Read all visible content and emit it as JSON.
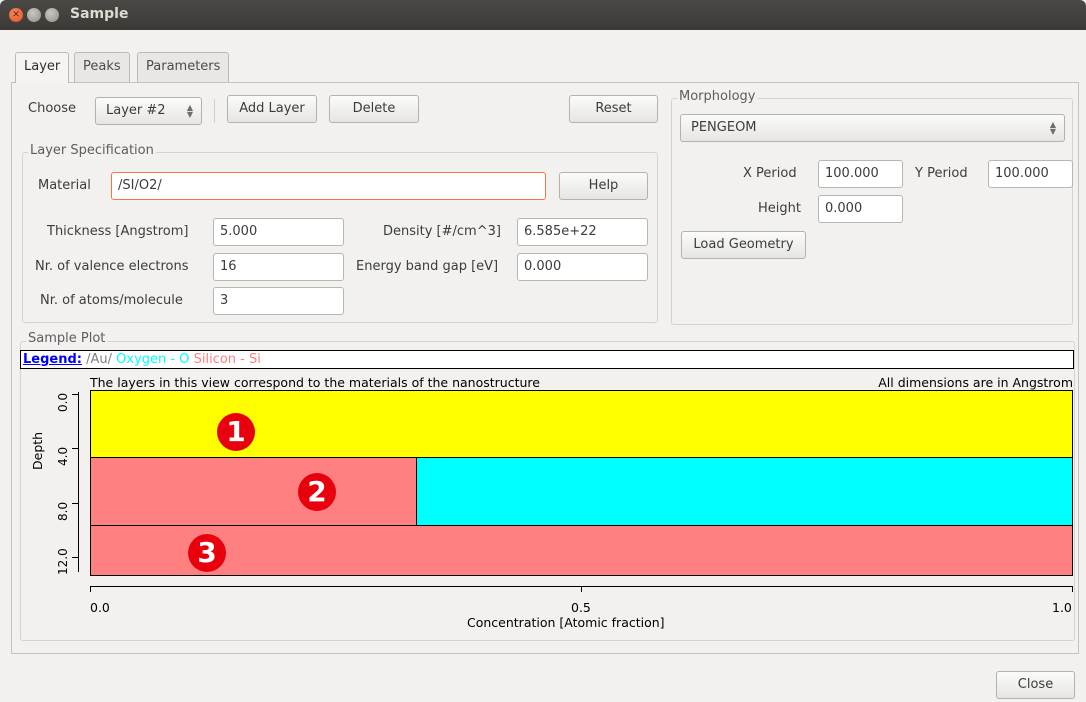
{
  "window": {
    "title": "Sample"
  },
  "tabs": [
    {
      "label": "Layer",
      "active": true
    },
    {
      "label": "Peaks",
      "active": false
    },
    {
      "label": "Parameters",
      "active": false
    }
  ],
  "toolbar": {
    "choose_label": "Choose",
    "layer_select": "Layer #2",
    "add_layer": "Add Layer",
    "delete": "Delete",
    "reset": "Reset"
  },
  "layer_spec": {
    "title": "Layer Specification",
    "material_label": "Material",
    "material_value": "/SI/O2/",
    "help": "Help",
    "thickness_label": "Thickness [Angstrom]",
    "thickness_value": "5.000",
    "density_label": "Density [#/cm^3]",
    "density_value": "6.585e+22",
    "valence_label": "Nr. of valence electrons",
    "valence_value": "16",
    "bandgap_label": "Energy band gap [eV]",
    "bandgap_value": "0.000",
    "atoms_label": "Nr. of atoms/molecule",
    "atoms_value": "3"
  },
  "morphology": {
    "title": "Morphology",
    "select": "PENGEOM",
    "xperiod_label": "X Period",
    "xperiod_value": "100.000",
    "yperiod_label": "Y Period",
    "yperiod_value": "100.000",
    "height_label": "Height",
    "height_value": "0.000",
    "load_geometry": "Load Geometry"
  },
  "plot": {
    "title": "Sample Plot",
    "legend_title": "Legend:",
    "legend_items": [
      {
        "label": "/Au/",
        "color": "#808080"
      },
      {
        "label": "Oxygen - O",
        "color": "#00ffff"
      },
      {
        "label": "Silicon - Si",
        "color": "#ff8080"
      }
    ],
    "note_left": "The layers in this view correspond to the materials of the nanostructure",
    "note_right": "All dimensions are in Angstrom",
    "y_label": "Depth",
    "x_label": "Concentration [Atomic fraction]",
    "y_ticks": [
      "0.0",
      "4.0",
      "8.0",
      "12.0"
    ],
    "x_ticks": [
      "0.0",
      "0.5",
      "1.0"
    ],
    "badges": [
      "1",
      "2",
      "3"
    ],
    "colors": {
      "yellow": "#ffff00",
      "silicon": "#ff8080",
      "oxygen": "#00ffff"
    },
    "layers": [
      {
        "depth_from": 0,
        "depth_to": 5,
        "segments": [
          {
            "fraction": 1.0,
            "color": "#ffff00"
          }
        ]
      },
      {
        "depth_from": 5,
        "depth_to": 10,
        "segments": [
          {
            "fraction": 0.333,
            "color": "#ff8080"
          },
          {
            "fraction": 0.667,
            "color": "#00ffff"
          }
        ]
      },
      {
        "depth_from": 10,
        "depth_to": 13.7,
        "segments": [
          {
            "fraction": 1.0,
            "color": "#ff8080"
          }
        ]
      }
    ]
  },
  "footer": {
    "close": "Close"
  }
}
